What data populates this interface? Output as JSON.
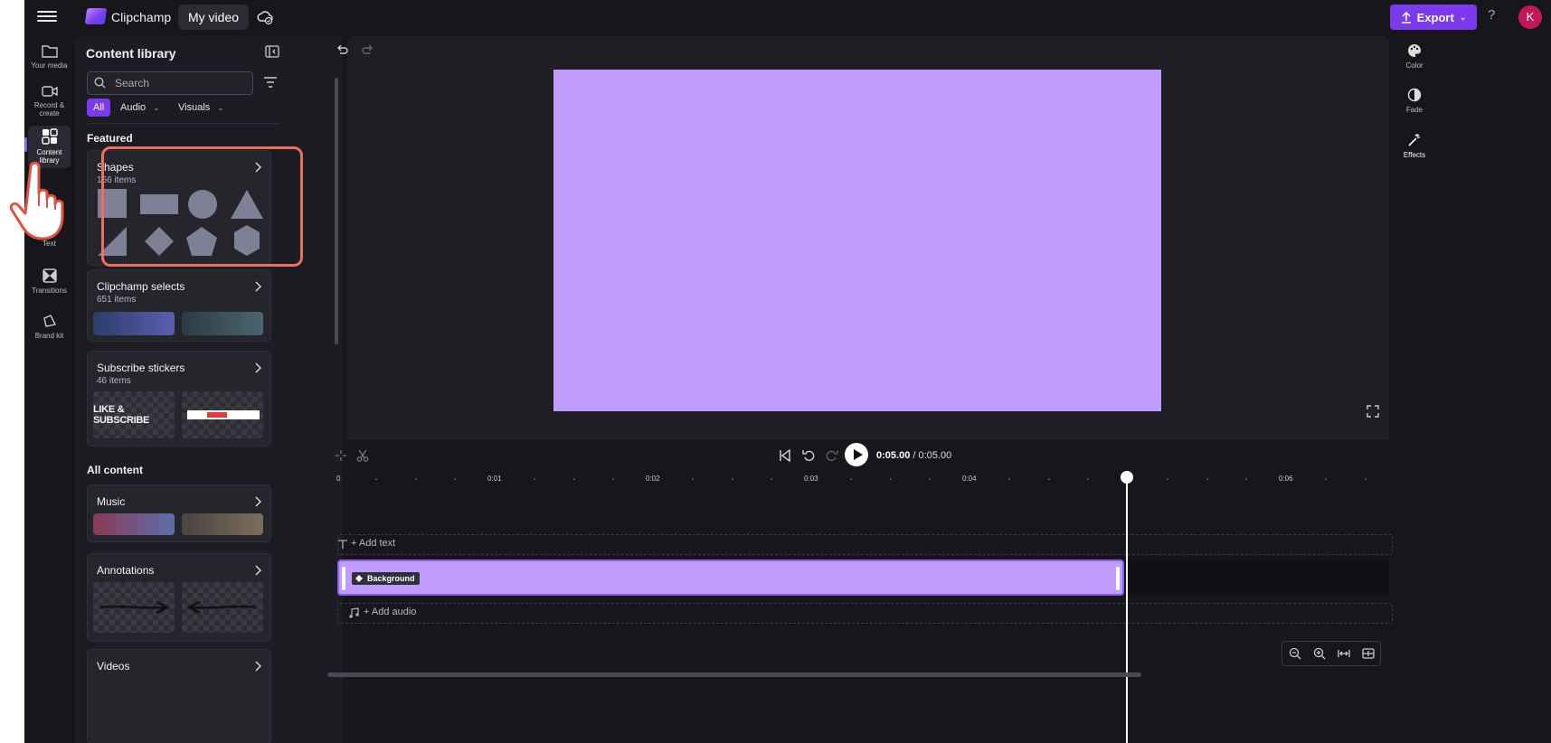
{
  "topbar": {
    "app_name": "Clipchamp",
    "project_tab": "My video",
    "export_label": "Export",
    "help": "?",
    "avatar_initial": "K"
  },
  "leftnav": {
    "items": [
      {
        "label": "Your media",
        "icon": "folder-icon"
      },
      {
        "label": "Record & create",
        "icon": "camera-icon"
      },
      {
        "label": "Content library",
        "icon": "content-library-icon"
      },
      {
        "label": "Text",
        "icon": "text-icon"
      },
      {
        "label": "Transitions",
        "icon": "transitions-icon"
      },
      {
        "label": "Brand kit",
        "icon": "brand-kit-icon"
      }
    ]
  },
  "library": {
    "title": "Content library",
    "search_placeholder": "Search",
    "filters": [
      "All",
      "Audio",
      "Visuals"
    ],
    "featured_title": "Featured",
    "all_content_title": "All content",
    "featured": [
      {
        "title": "Shapes",
        "count": "166 items"
      },
      {
        "title": "Clipchamp selects",
        "count": "651 items"
      },
      {
        "title": "Subscribe stickers",
        "count": "46 items"
      }
    ],
    "all_content": [
      {
        "title": "Music"
      },
      {
        "title": "Annotations"
      },
      {
        "title": "Videos"
      }
    ],
    "sticker_text": "LIKE & SUBSCRIBE"
  },
  "editor": {
    "preview_color": "#BF9CFD",
    "time_current": "0:05.00",
    "time_total": "/ 0:05.00",
    "ruler": [
      "0",
      "0:01",
      "0:02",
      "0:03",
      "0:04",
      "0:06"
    ],
    "add_text_label": "+ Add text",
    "clip_label": "Background",
    "add_audio_label": "+ Add audio"
  },
  "rightnav": {
    "items": [
      {
        "label": "Color",
        "icon": "palette-icon"
      },
      {
        "label": "Fade",
        "icon": "fade-icon"
      },
      {
        "label": "Effects",
        "icon": "magic-wand-icon"
      }
    ]
  },
  "colors": {
    "accent": "#7C3AED",
    "highlight": "#EF6F5F",
    "background_clip": "#BF9CFD"
  }
}
